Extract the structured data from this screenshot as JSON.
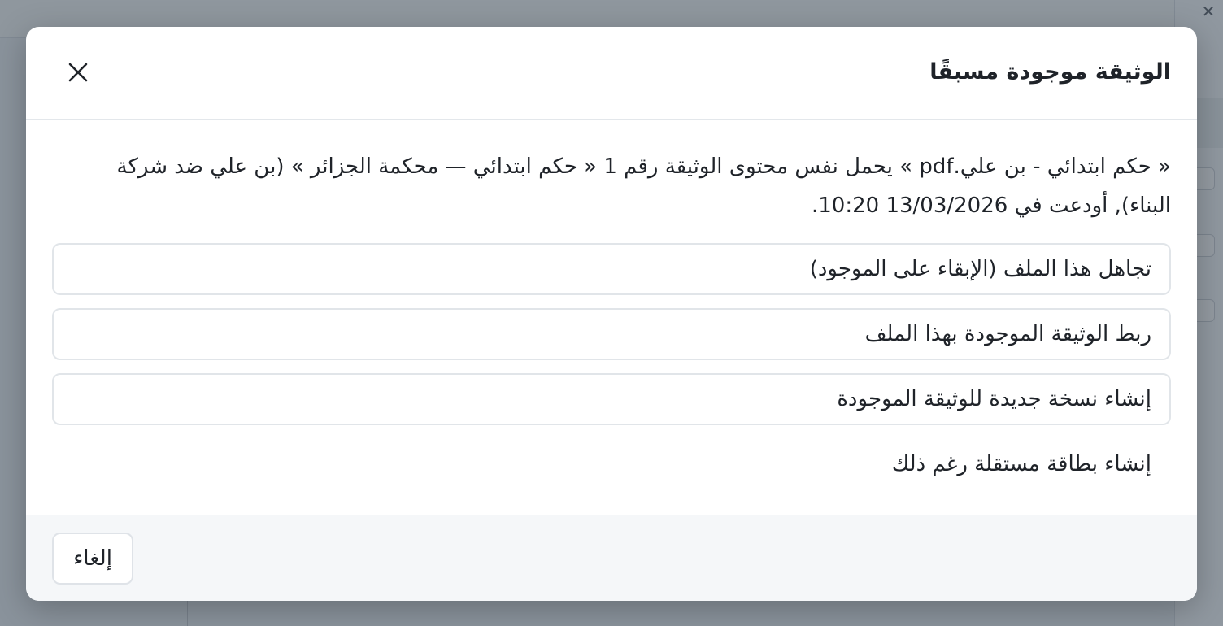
{
  "dialog": {
    "title": "الوثيقة موجودة مسبقًا",
    "message_line1": "« حكم ابتدائي - بن علي.pdf » يحمل نفس محتوى الوثيقة رقم 1 « حكم ابتدائي — محكمة الجزائر » (بن علي ضد شركة",
    "message_line2": "البناء), أودعت في 13/03/2026 10:20.",
    "options": [
      {
        "label": "تجاهل هذا الملف (الإبقاء على الموجود)"
      },
      {
        "label": "ربط الوثيقة الموجودة بهذا الملف"
      },
      {
        "label": "إنشاء نسخة جديدة للوثيقة الموجودة"
      },
      {
        "label": "إنشاء بطاقة مستقلة رغم ذلك"
      }
    ],
    "cancel_label": "إلغاء"
  },
  "icons": {
    "close": "close-icon"
  }
}
